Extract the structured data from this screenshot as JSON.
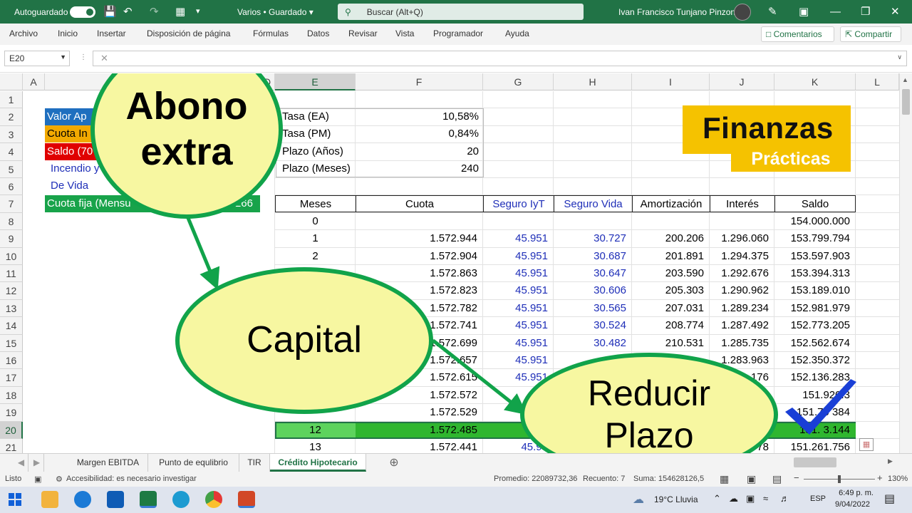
{
  "titlebar": {
    "autosave_label": "Autoguardado",
    "doc_title": "Varios • Guardado",
    "search_placeholder": "Buscar (Alt+Q)",
    "user_name": "Ivan Francisco Tunjano Pinzon"
  },
  "ribbon": {
    "tabs": [
      "Archivo",
      "Inicio",
      "Insertar",
      "Disposición de página",
      "Fórmulas",
      "Datos",
      "Revisar",
      "Vista",
      "Programador",
      "Ayuda"
    ],
    "comments_label": "Comentarios",
    "share_label": "Compartir"
  },
  "formula_bar": {
    "name_box": "E20"
  },
  "columns": [
    "A",
    "B",
    "C",
    "D",
    "E",
    "F",
    "G",
    "H",
    "I",
    "J",
    "K",
    "L"
  ],
  "rows": [
    "1",
    "2",
    "3",
    "4",
    "5",
    "6",
    "7",
    "8",
    "9",
    "10",
    "11",
    "12",
    "13",
    "14",
    "15",
    "16",
    "17",
    "18",
    "19",
    "20",
    "21"
  ],
  "left_labels": {
    "valor": "Valor Ap",
    "cuota_inicial": "Cuota In",
    "saldo": "Saldo (70",
    "incendio": "Incendio y",
    "de_vida": "De Vida",
    "cuota_fija": "Cuota fija (Mensu",
    "cuota_fija_val": "266"
  },
  "params": {
    "tasa_ea_label": "Tasa (EA)",
    "tasa_ea": "10,58%",
    "tasa_pm_label": "Tasa (PM)",
    "tasa_pm": "0,84%",
    "plazo_anos_label": "Plazo (Años)",
    "plazo_anos": "20",
    "plazo_meses_label": "Plazo (Meses)",
    "plazo_meses": "240"
  },
  "logo": {
    "line1": "Finanzas",
    "line2": "Prácticas"
  },
  "table": {
    "headers": [
      "Meses",
      "Cuota",
      "Seguro IyT",
      "Seguro Vida",
      "Amortización",
      "Interés",
      "Saldo"
    ],
    "rows": [
      [
        "0",
        "",
        "",
        "",
        "",
        "",
        "154.000.000"
      ],
      [
        "1",
        "1.572.944",
        "45.951",
        "30.727",
        "200.206",
        "1.296.060",
        "153.799.794"
      ],
      [
        "2",
        "1.572.904",
        "45.951",
        "30.687",
        "201.891",
        "1.294.375",
        "153.597.903"
      ],
      [
        "",
        "1.572.863",
        "45.951",
        "30.647",
        "203.590",
        "1.292.676",
        "153.394.313"
      ],
      [
        "",
        "1.572.823",
        "45.951",
        "30.606",
        "205.303",
        "1.290.962",
        "153.189.010"
      ],
      [
        "",
        "1.572.782",
        "45.951",
        "30.565",
        "207.031",
        "1.289.234",
        "152.981.979"
      ],
      [
        "",
        "1.572.741",
        "45.951",
        "30.524",
        "208.774",
        "1.287.492",
        "152.773.205"
      ],
      [
        "",
        "1.572.699",
        "45.951",
        "30.482",
        "210.531",
        "1.285.735",
        "152.562.674"
      ],
      [
        "",
        "1.572.657",
        "45.951",
        "",
        "",
        "1.283.963",
        "152.350.372"
      ],
      [
        "",
        "1.572.615",
        "45.951",
        "",
        "",
        "176",
        "152.136.283"
      ],
      [
        "",
        "1.572.572",
        "45.9",
        "",
        "",
        "",
        "151.920.3"
      ],
      [
        "",
        "1.572.529",
        "",
        "",
        "",
        "",
        "151.70 384"
      ],
      [
        "12",
        "1.572.485",
        "45.",
        "",
        "",
        "",
        "151. 3.144"
      ],
      [
        "13",
        "1.572.441",
        "45.95",
        "",
        "",
        "78",
        "151.261.756"
      ]
    ]
  },
  "bubbles": {
    "abono": "Abono extra",
    "capital": "Capital",
    "reducir": "Reducir Plazo"
  },
  "sheet_tabs": [
    "Margen EBITDA",
    "Punto de equlibrio",
    "TIR",
    "Crédito Hipotecario"
  ],
  "status": {
    "ready": "Listo",
    "accessibility": "Accesibilidad: es necesario investigar",
    "promedio": "Promedio: 22089732,36",
    "recuento": "Recuento: 7",
    "suma": "Suma: 154628126,5",
    "zoom": "130%"
  },
  "taskbar": {
    "weather": "19°C  Lluvia",
    "lang": "ESP",
    "time": "6:49 p. m.",
    "date": "9/04/2022"
  },
  "colors": {
    "excel_green": "#217346",
    "bubble_fill": "#f7f7a1",
    "bubble_border": "#11a34a",
    "logo_yellow": "#f5c200",
    "row_highlight": "#5dd35d"
  }
}
